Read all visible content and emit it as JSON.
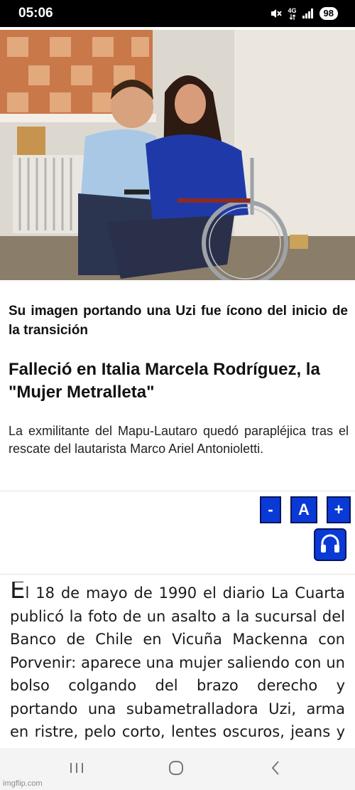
{
  "status_bar": {
    "time": "05:06",
    "network": "4G",
    "battery": "98",
    "icons": [
      "mute-icon",
      "network-4g-icon",
      "signal-icon",
      "battery-icon"
    ]
  },
  "article": {
    "kicker": "Su imagen portando una Uzi fue ícono del inicio de la transición",
    "headline": "Falleció en Italia Marcela Rodríguez, la \"Mujer Metralleta\"",
    "lead": "La exmilitante del Mapu-Lautaro quedó parapléjica tras el rescate del lautarista Marco Ariel Antonioletti.",
    "body_dropcap": "E",
    "body_text": "l 18 de mayo de 1990 el diario La Cuarta publicó la foto de un asalto a la sucursal del Banco de Chile en Vicuña Mackenna con Porvenir: aparece una mujer saliendo con un bolso colgando del brazo derecho y portando una subametralladora Uzi, arma en ristre, pelo corto, lentes oscuros, jeans y con"
  },
  "tools": {
    "decrease_label": "-",
    "font_label": "A",
    "increase_label": "+",
    "audio_icon": "headphones-icon",
    "accent_color": "#0a3ad6"
  },
  "nav": {
    "icons": [
      "recents-icon",
      "home-icon",
      "back-icon"
    ]
  },
  "watermark": "imgflip.com"
}
